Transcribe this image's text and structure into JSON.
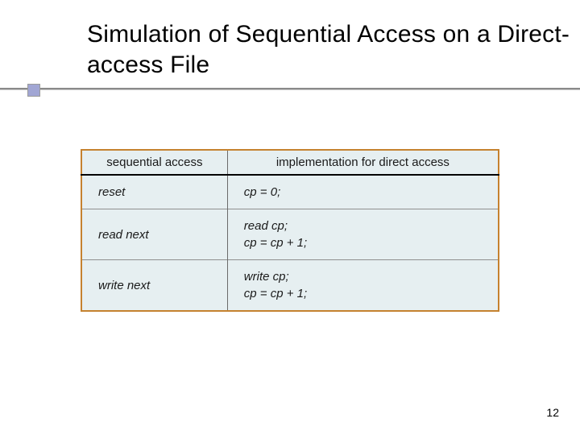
{
  "title": "Simulation of Sequential Access on a Direct-access File",
  "table": {
    "headers": [
      "sequential access",
      "implementation for direct access"
    ],
    "rows": [
      {
        "op": "reset",
        "impl": "cp = 0;"
      },
      {
        "op": "read next",
        "impl": "read cp;\ncp = cp + 1;"
      },
      {
        "op": "write next",
        "impl": "write cp;\ncp = cp + 1;"
      }
    ]
  },
  "page_number": "12"
}
